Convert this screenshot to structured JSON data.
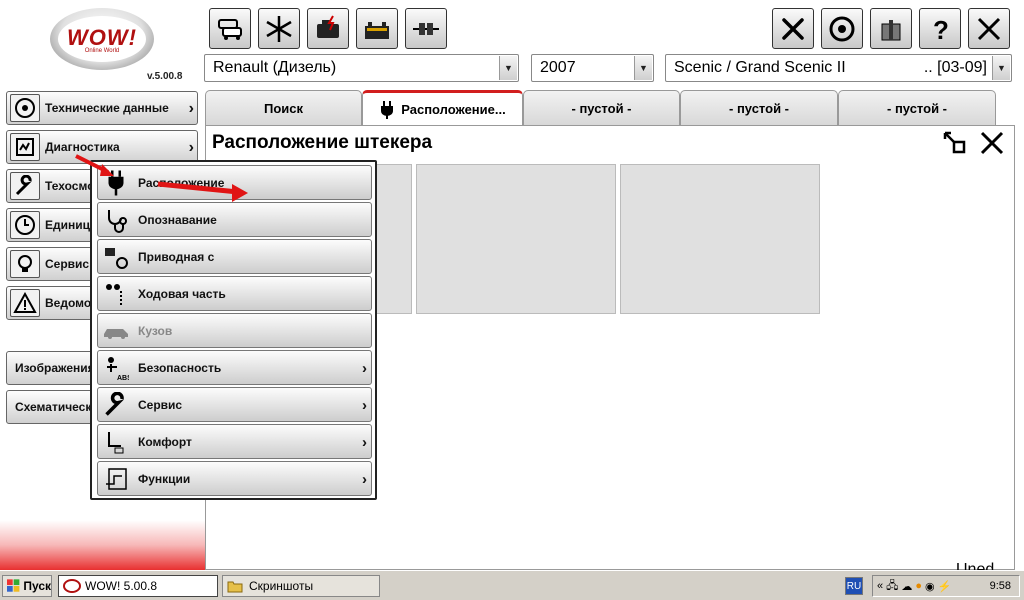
{
  "app": {
    "version": "v.5.00.8",
    "logo_text": "WOW!",
    "logo_sub": "Online World"
  },
  "toolbar": {
    "left_icons": [
      "vehicles-icon",
      "snowflake-icon",
      "engine-icon",
      "battery-icon",
      "connector-icon"
    ],
    "right_icons": [
      "tools-icon",
      "brake-icon",
      "gift-icon",
      "help-icon",
      "close-icon"
    ]
  },
  "selectors": {
    "make": "Renault (Дизель)",
    "year": "2007",
    "model": "Scenic / Grand Scenic II",
    "model_range": ".. [03-09]"
  },
  "tabs": [
    {
      "label": "Поиск"
    },
    {
      "label": "Расположение..."
    },
    {
      "label": "-  пустой  -"
    },
    {
      "label": "-  пустой  -"
    },
    {
      "label": "-  пустой  -"
    }
  ],
  "panel": {
    "title": "Расположение штекера"
  },
  "sidebar": {
    "items": [
      {
        "label": "Технические данные"
      },
      {
        "label": "Диагностика"
      },
      {
        "label": "Техосмотр"
      },
      {
        "label": "Единицы"
      },
      {
        "label": "Сервис"
      },
      {
        "label": "Ведомости"
      }
    ],
    "lower": [
      {
        "label": "Изображения"
      },
      {
        "label": "Схематические"
      }
    ]
  },
  "submenu": {
    "items": [
      {
        "label": "Расположение"
      },
      {
        "label": "Опознавание"
      },
      {
        "label": "Приводная с"
      },
      {
        "label": "Ходовая часть"
      },
      {
        "label": "Кузов"
      },
      {
        "label": "Безопасность"
      },
      {
        "label": "Сервис"
      },
      {
        "label": "Комфорт"
      },
      {
        "label": "Функции"
      }
    ]
  },
  "taskbar": {
    "start": "Пуск",
    "tasks": [
      {
        "label": "WOW! 5.00.8"
      },
      {
        "label": "Скриншоты"
      }
    ],
    "lang": "RU",
    "tray_chevron": "«",
    "clock": "9:58"
  },
  "watermark": "Uned",
  "colors": {
    "accent_red": "#d21e1e",
    "taskbar": "#d4d0c8"
  }
}
